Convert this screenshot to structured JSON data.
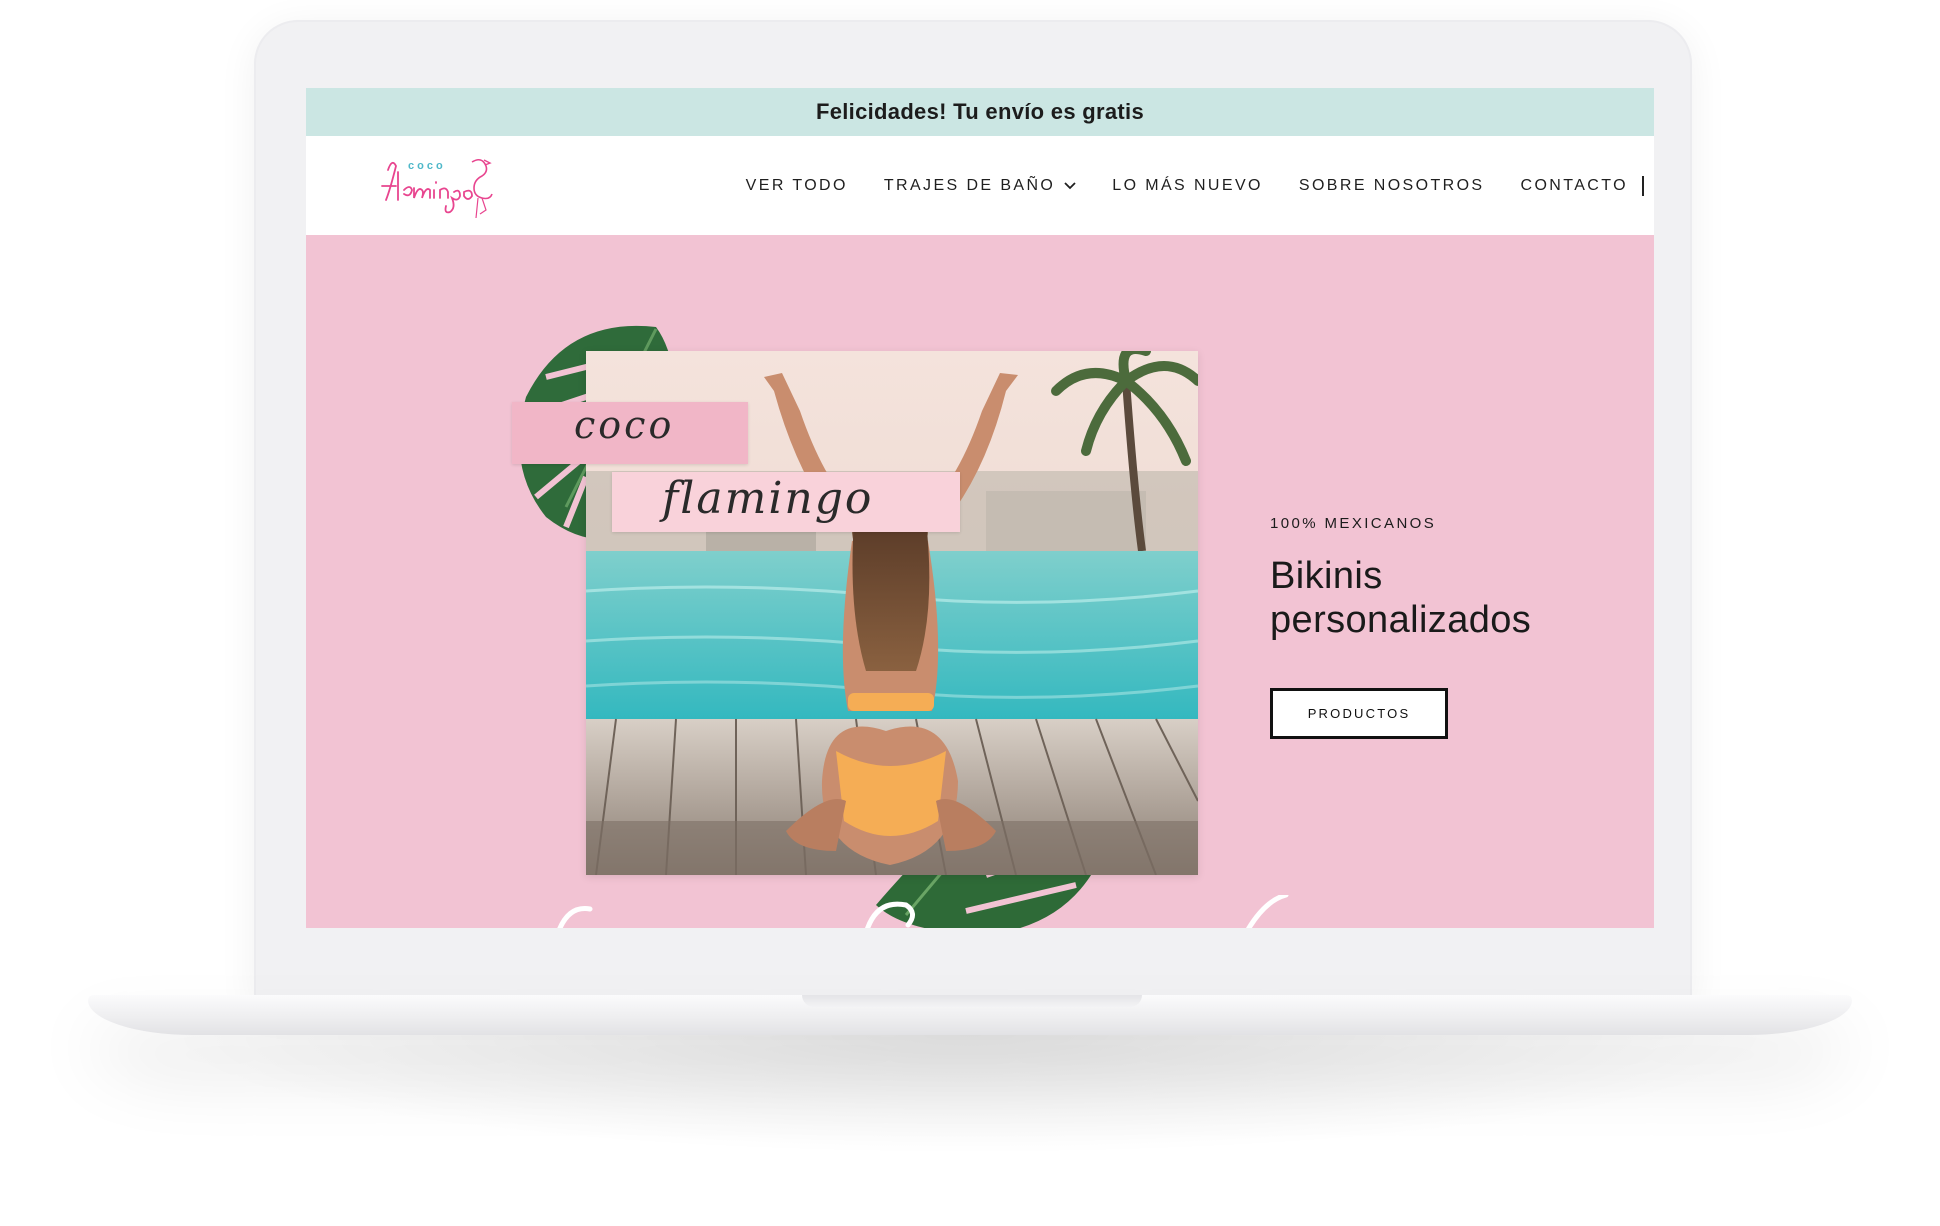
{
  "announcement": {
    "text": "Felicidades! Tu envío es gratis"
  },
  "header": {
    "logo_top": "coco",
    "logo_main": "flamingo",
    "nav": [
      {
        "label": "VER TODO",
        "has_dropdown": false
      },
      {
        "label": "TRAJES DE BAÑO",
        "has_dropdown": true
      },
      {
        "label": "LO MÁS NUEVO",
        "has_dropdown": false
      },
      {
        "label": "SOBRE NOSOTROS",
        "has_dropdown": false
      },
      {
        "label": "CONTACTO",
        "has_dropdown": false
      }
    ]
  },
  "hero": {
    "tape_coco": "coco",
    "tape_flamingo": "flamingo",
    "eyebrow": "100% MEXICANOS",
    "headline_line1": "Bikinis",
    "headline_line2": "personalizados",
    "cta_label": "PRODUCTOS",
    "background_color": "#f2c3d3"
  },
  "colors": {
    "announcement_bg": "#cbe6e3",
    "logo_pink": "#e8458f",
    "logo_teal": "#4fb8c9",
    "leaf_green": "#2f6b3a",
    "water": "#52c3c6"
  },
  "icons": {
    "dropdown": "chevron-down-icon",
    "flamingo": "flamingo-icon",
    "leaf": "monstera-leaf-icon"
  }
}
